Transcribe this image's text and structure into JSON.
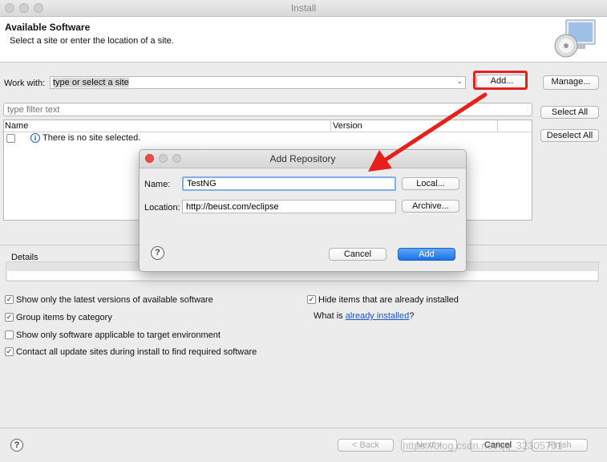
{
  "window": {
    "title": "Install"
  },
  "header": {
    "title": "Available Software",
    "subtitle": "Select a site or enter the location of a site."
  },
  "work_with": {
    "label": "Work with:",
    "value": "type or select a site",
    "add_label": "Add...",
    "manage_label": "Manage..."
  },
  "filter": {
    "placeholder": "type filter text"
  },
  "table": {
    "col_name": "Name",
    "col_version": "Version",
    "empty_message": "There is no site selected."
  },
  "side_buttons": {
    "select_all": "Select All",
    "deselect_all": "Deselect All"
  },
  "details": {
    "label": "Details"
  },
  "options": {
    "show_latest": "Show only the latest versions of available software",
    "group_items": "Group items by category",
    "show_applicable": "Show only software applicable to target environment",
    "contact_sites": "Contact all update sites during install to find required software",
    "hide_installed": "Hide items that are already installed",
    "what_is_prefix": "What is ",
    "what_is_link": "already installed",
    "what_is_suffix": "?"
  },
  "footer": {
    "back": "< Back",
    "next": "Next >",
    "cancel": "Cancel",
    "finish": "Finish"
  },
  "dialog": {
    "title": "Add Repository",
    "name_label": "Name:",
    "name_value": "TestNG",
    "location_label": "Location:",
    "location_value": "http://beust.com/eclipse",
    "local_label": "Local...",
    "archive_label": "Archive...",
    "cancel_label": "Cancel",
    "add_label": "Add"
  },
  "watermark": "https://blog.csdn.net/qq_32305701",
  "colors": {
    "accent": "#1a73e8",
    "highlight_red": "#e8201c",
    "link": "#1a55c9"
  }
}
